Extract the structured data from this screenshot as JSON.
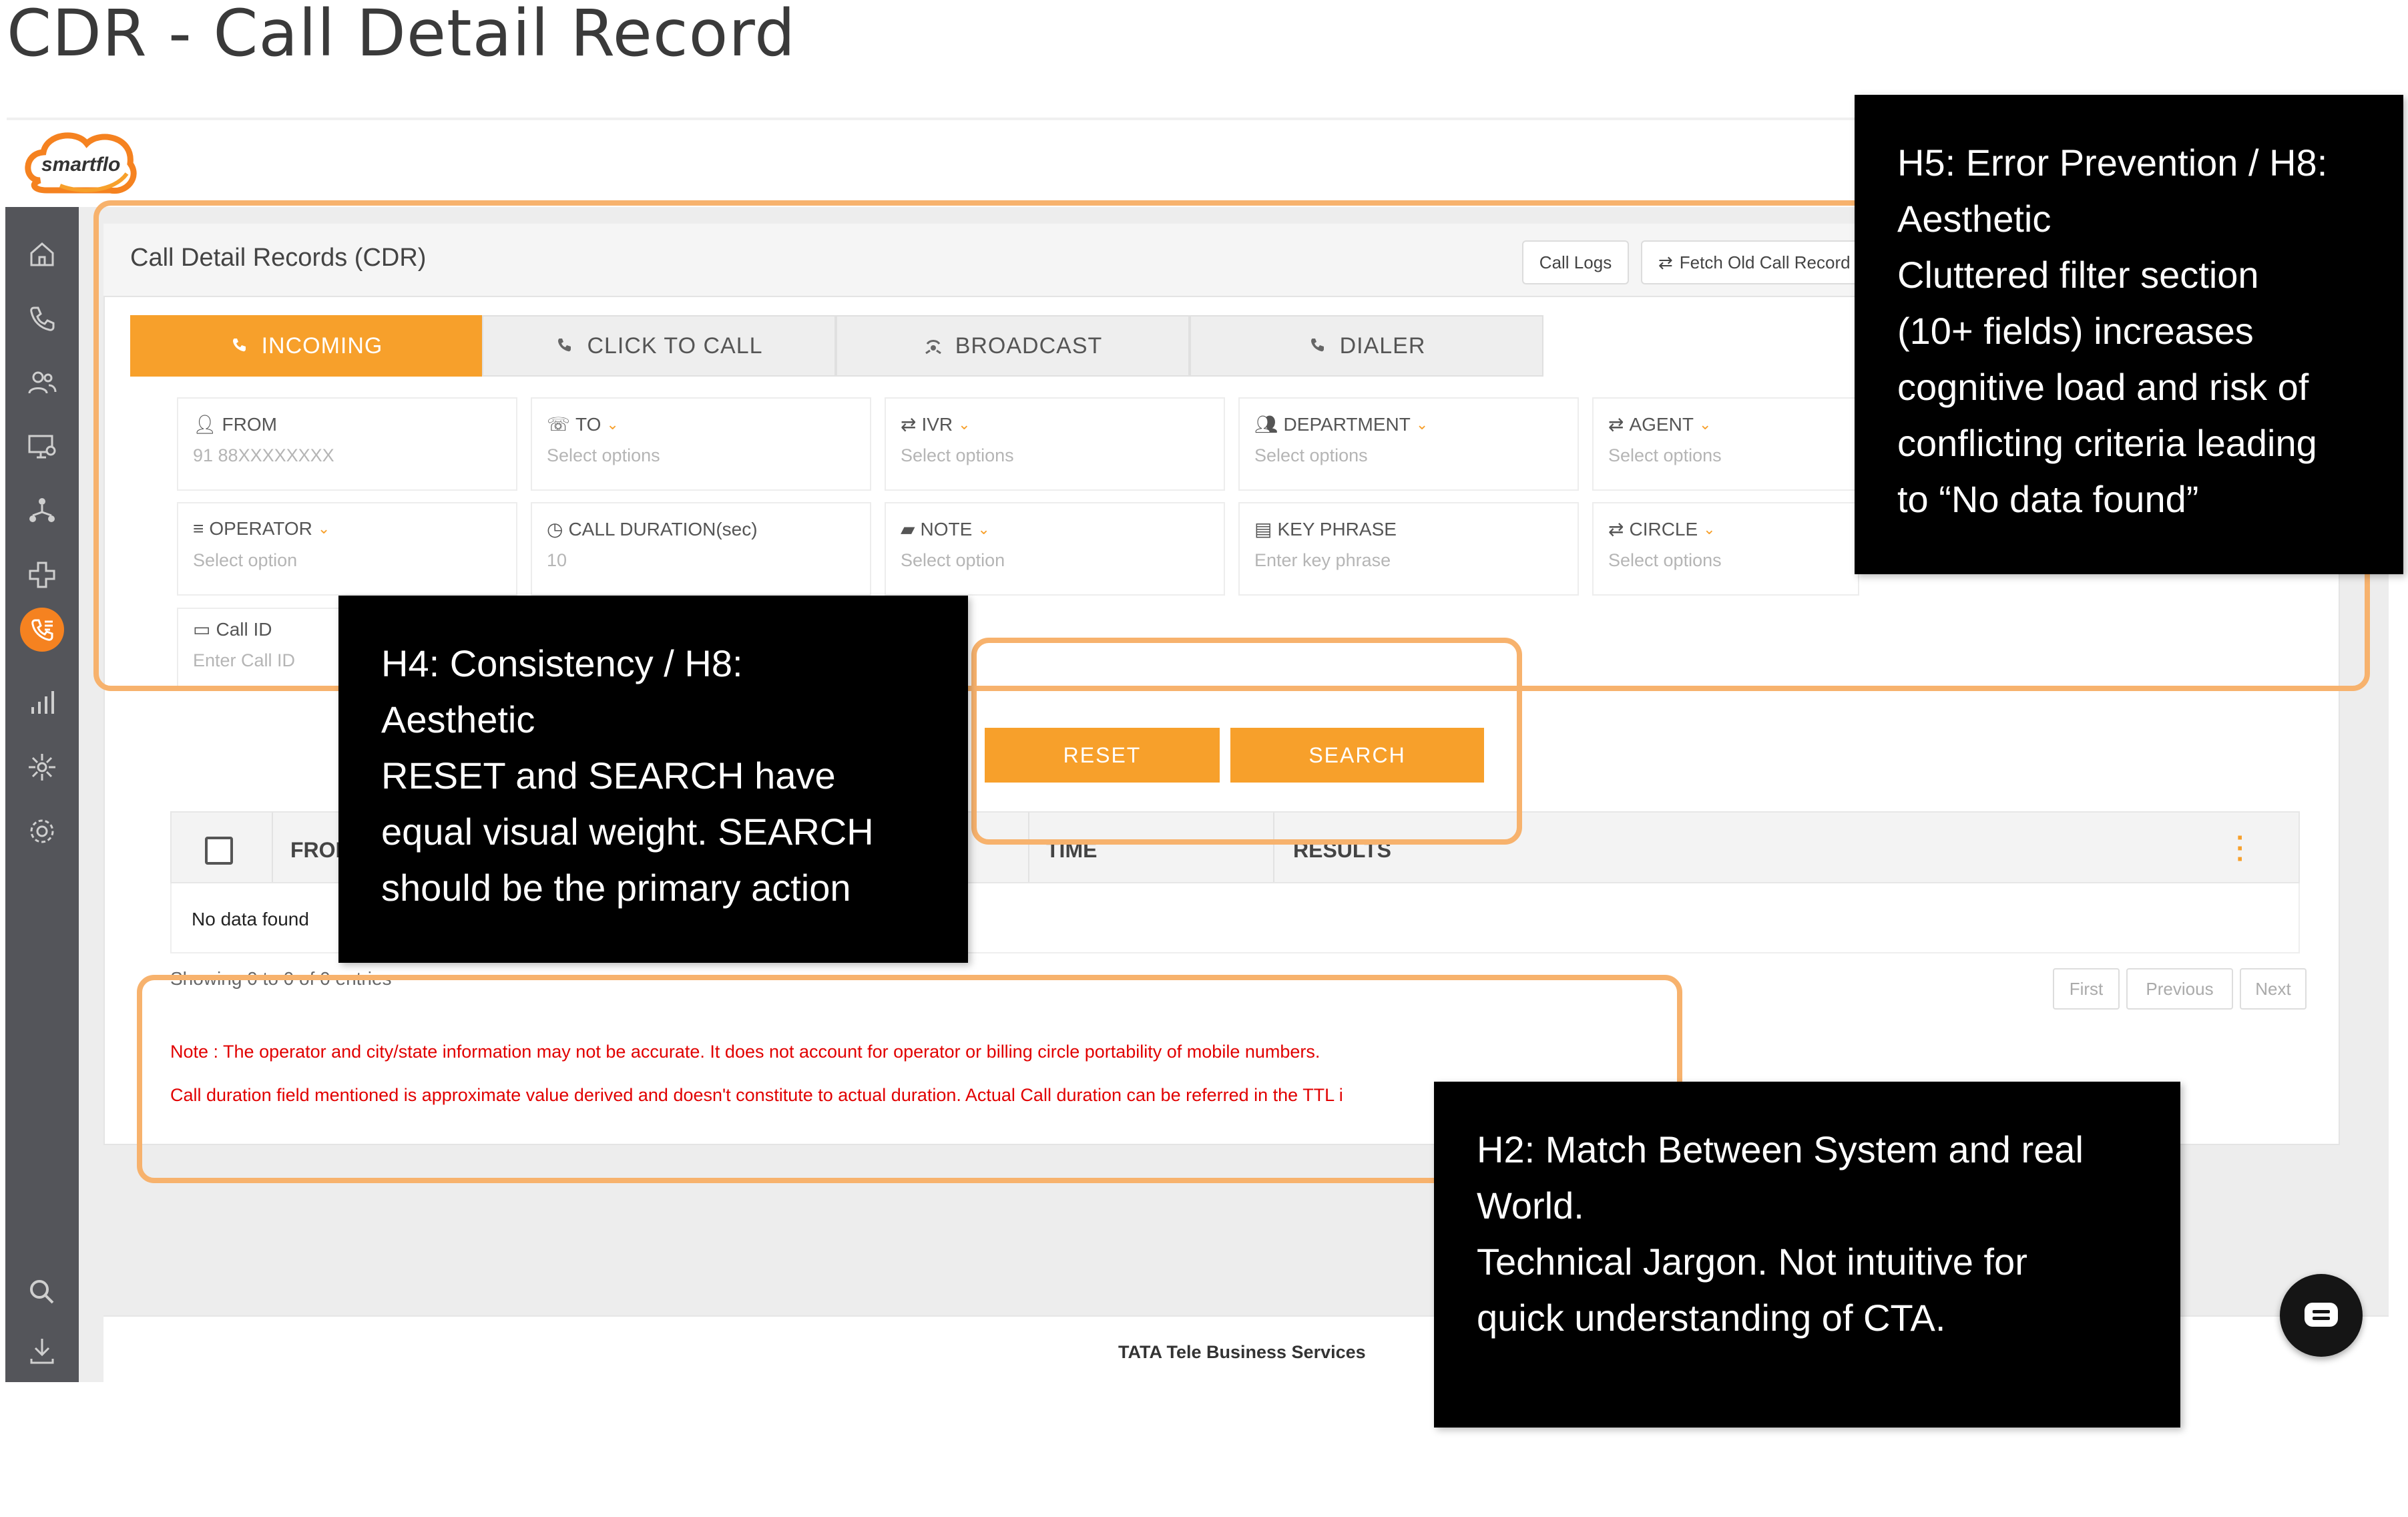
{
  "slide": {
    "title": "CDR - Call Detail Record"
  },
  "app": {
    "logo_text": "smartflo",
    "card_title": "Call Detail Records (CDR)",
    "header_buttons": {
      "call_logs": "Call Logs",
      "fetch_old": "Fetch Old Call Record"
    },
    "tabs": [
      {
        "label": "INCOMING",
        "icon": "phone-incoming-icon"
      },
      {
        "label": "CLICK TO CALL",
        "icon": "phone-click-icon"
      },
      {
        "label": "BROADCAST",
        "icon": "broadcast-icon"
      },
      {
        "label": "DIALER",
        "icon": "dialer-icon"
      }
    ],
    "filters": {
      "from": {
        "label": "FROM",
        "value": "91 88XXXXXXXX"
      },
      "to": {
        "label": "TO",
        "placeholder": "Select options"
      },
      "ivr": {
        "label": "IVR",
        "placeholder": "Select options"
      },
      "department": {
        "label": "DEPARTMENT",
        "placeholder": "Select options"
      },
      "agent": {
        "label": "AGENT",
        "placeholder": "Select options"
      },
      "operator": {
        "label": "OPERATOR",
        "placeholder": "Select option"
      },
      "call_duration": {
        "label": "CALL DURATION(sec)",
        "value": "10"
      },
      "note": {
        "label": "NOTE",
        "placeholder": "Select option"
      },
      "key_phrase": {
        "label": "KEY PHRASE",
        "placeholder": "Enter key phrase"
      },
      "circle": {
        "label": "CIRCLE",
        "placeholder": "Select options"
      },
      "call_id": {
        "label": "Call ID",
        "placeholder": "Enter Call ID"
      }
    },
    "buttons": {
      "reset": "RESET",
      "search": "SEARCH"
    },
    "table": {
      "columns": [
        "FROM",
        "TIME",
        "RESULTS"
      ],
      "empty_text": "No data found",
      "showing": "Showing 0 to 0 of 0 entries"
    },
    "pagination": {
      "first": "First",
      "previous": "Previous",
      "next": "Next"
    },
    "notes": [
      "Note : The operator and city/state information may not be accurate. It does not account for operator or billing circle portability of mobile numbers.",
      "Call duration field mentioned is approximate value derived and doesn't constitute to actual duration. Actual Call duration can be referred in the TTL i"
    ],
    "footer": "TATA Tele Business Services"
  },
  "annotations": {
    "h5": [
      "H5: Error Prevention / H8:",
      "Aesthetic",
      "Cluttered filter section",
      "(10+ fields) increases",
      "cognitive load and risk of",
      "conflicting criteria leading",
      "to “No data found”"
    ],
    "h4": [
      "H4: Consistency  / H8:",
      "Aesthetic",
      "RESET and SEARCH have",
      "equal visual weight. SEARCH",
      "should be the primary action"
    ],
    "h2": [
      "H2: Match Between System and real",
      "World.",
      "Technical Jargon. Not intuitive for",
      "quick understanding of CTA."
    ]
  },
  "colors": {
    "accent": "#f7a02b",
    "highlight": "#f7b26d",
    "sidebar": "#54555a",
    "note_red": "#e10000"
  }
}
